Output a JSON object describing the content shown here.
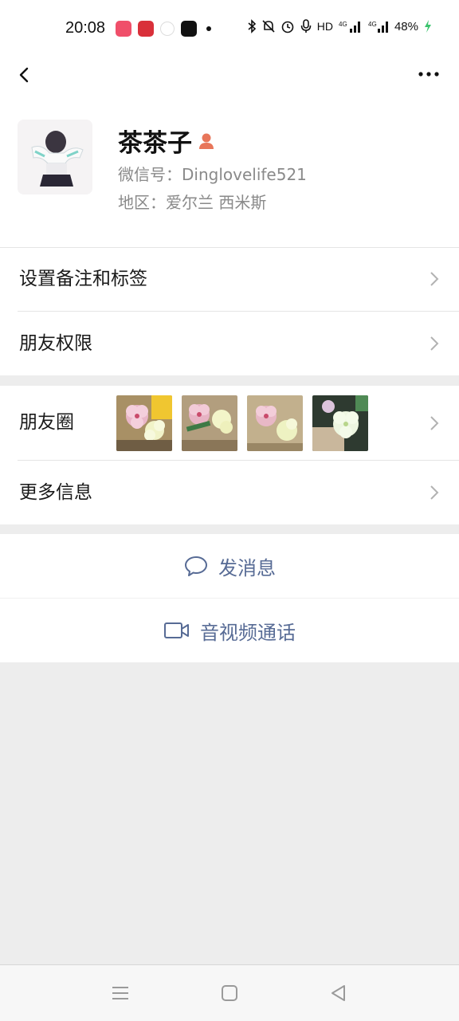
{
  "status_bar": {
    "time": "20:08",
    "network_label": "HD",
    "battery": "48%",
    "icons": [
      "bluetooth-icon",
      "mute-bell-icon",
      "alarm-icon",
      "mic-icon",
      "signal-4g-icon",
      "signal-4g-icon",
      "charging-icon"
    ]
  },
  "nav": {
    "back_icon": "chevron-left-icon",
    "more_icon": "more-dots-icon"
  },
  "profile": {
    "name": "茶茶子",
    "wechat_id": "微信号：Dinglovelife521",
    "region": "地区：爱尔兰 西米斯",
    "gender_icon": "female-person-icon",
    "gender_color": "#e8765a"
  },
  "rows": {
    "remark_tags": "设置备注和标签",
    "friend_permissions": "朋友权限",
    "moments": "朋友圈",
    "more_info": "更多信息"
  },
  "actions": {
    "send_message": "发消息",
    "voice_video_call": "音视频通话"
  },
  "colors": {
    "link_blue": "#576b95",
    "page_gray": "#ededed",
    "text_gray": "#8a8a8a"
  }
}
